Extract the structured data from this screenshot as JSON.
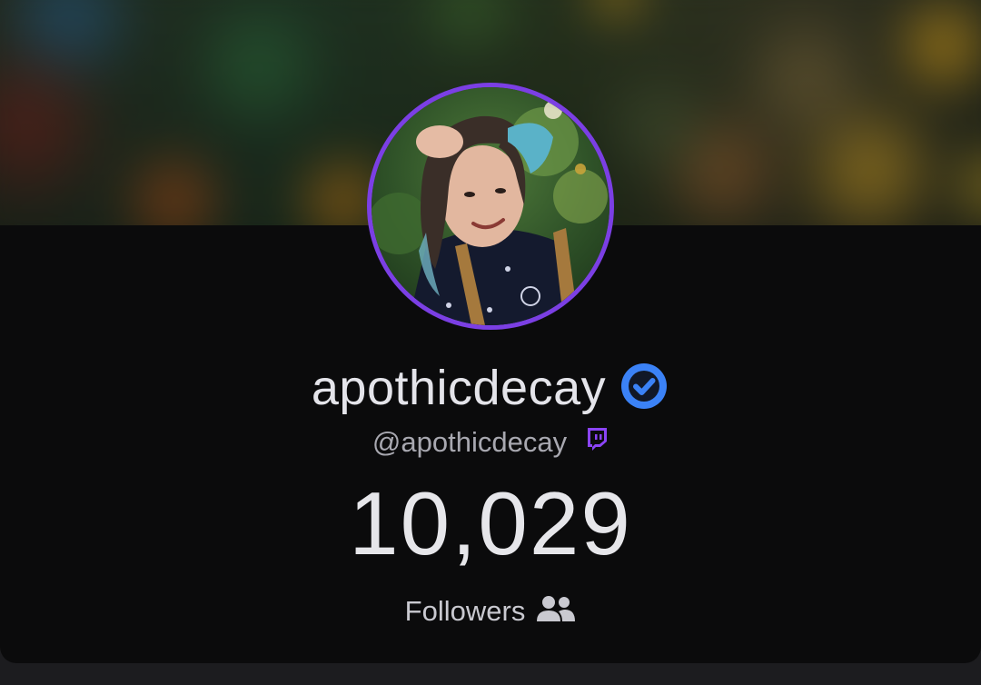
{
  "profile": {
    "display_name": "apothicdecay",
    "handle": "@apothicdecay",
    "verified_icon": "verified-check-icon",
    "platform_icon": "twitch-icon",
    "avatar": "profile-photo",
    "banner": "blurred-banner-image"
  },
  "stats": {
    "follower_count": "10,029",
    "followers_label": "Followers",
    "followers_icon": "users-icon"
  },
  "colors": {
    "accent_purple": "#7b3fe4",
    "verified_blue": "#3b82f6",
    "twitch_purple": "#8b44f7",
    "card_background": "#0b0b0c"
  }
}
